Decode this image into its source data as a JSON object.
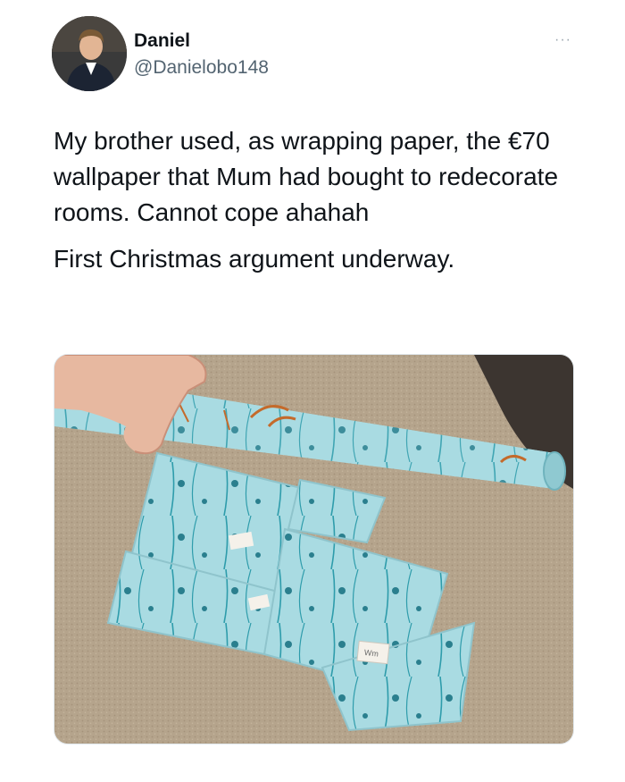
{
  "author": {
    "display_name": "Daniel",
    "handle": "@Danielobo148"
  },
  "menu": {
    "more_label": "···"
  },
  "tweet": {
    "paragraphs": [
      "My brother used, as wrapping paper, the €70 wallpaper that Mum had bought to redecorate rooms. Cannot cope ahahah",
      "First Christmas argument underway."
    ]
  },
  "photo": {
    "tag_label": "Wm"
  },
  "colors": {
    "text": "#0f1419",
    "secondary_text": "#536471",
    "carpet": "#b5a48c",
    "wallpaper": "#a9dbe2",
    "wallpaper_pattern": "#2e9cab",
    "wallpaper_accent": "#c46a2b"
  }
}
